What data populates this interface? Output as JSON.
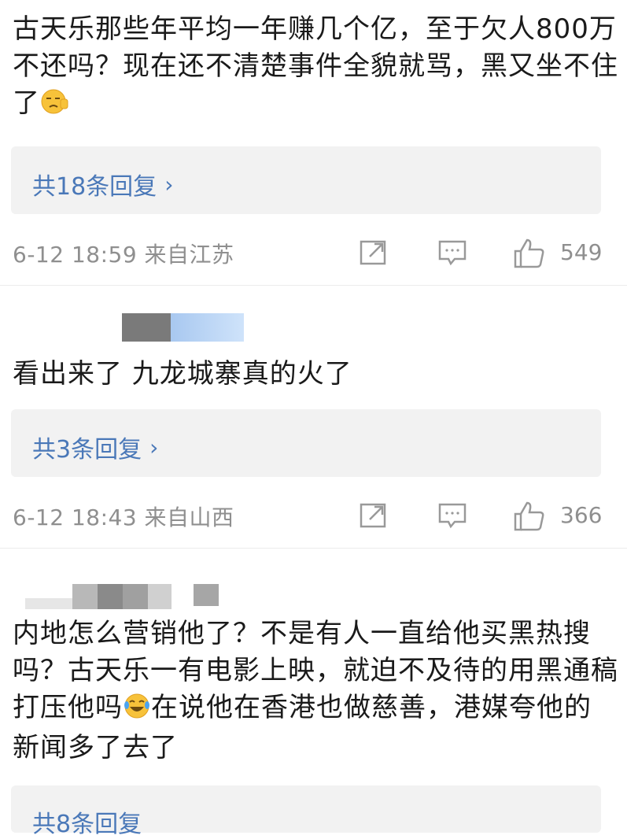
{
  "comments": [
    {
      "text": "古天乐那些年平均一年赚几个亿，至于欠人800万不还吗？现在还不清楚事件全貌就骂，黑又坐不住了",
      "emoji": "squinting-face-emoji",
      "replies_label": "共18条回复",
      "time": "6-12 18:59",
      "location": "来自江苏",
      "likes": "549"
    },
    {
      "text": "看出来了 九龙城寨真的火了",
      "replies_label": "共3条回复",
      "time": "6-12 18:43",
      "location": "来自山西",
      "likes": "366"
    },
    {
      "text_before_emoji": "内地怎么营销他了？不是有人一直给他买黑热搜吗？古天乐一有电影上映，就迫不及待的用黑通稿打压他吗",
      "emoji": "laughing-crying-emoji",
      "text_after_emoji": "在说他在香港也做慈善，港媒夸他的新闻多了去了",
      "replies_label": "共8条回复"
    }
  ],
  "colors": {
    "reply_link": "#4a78b8",
    "meta_gray": "#8f8f8f",
    "reply_bg": "#f2f2f2"
  }
}
